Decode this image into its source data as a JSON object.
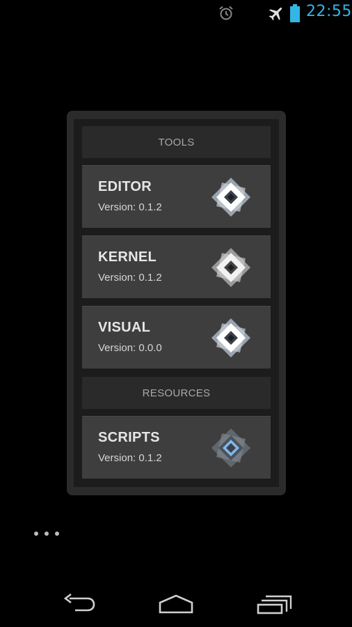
{
  "status_bar": {
    "time": "22:55",
    "icons": [
      "alarm-clock-icon",
      "airplane-mode-icon",
      "battery-icon"
    ],
    "clock_color": "#33b5e5"
  },
  "widget": {
    "sections": [
      {
        "header": "TOOLS",
        "items": [
          {
            "name": "EDITOR",
            "version": "Version: 0.1.2",
            "logo": "diamond-logo-light"
          },
          {
            "name": "KERNEL",
            "version": "Version: 0.1.2",
            "logo": "diamond-logo-light"
          },
          {
            "name": "VISUAL",
            "version": "Version: 0.0.0",
            "logo": "diamond-logo-light"
          }
        ]
      },
      {
        "header": "RESOURCES",
        "items": [
          {
            "name": "SCRIPTS",
            "version": "Version: 0.1.2",
            "logo": "diamond-logo-blue"
          }
        ]
      }
    ]
  },
  "overflow_menu": {
    "icon": "more-dots-icon"
  },
  "nav_bar": {
    "buttons": [
      "back-icon",
      "home-icon",
      "recents-icon"
    ]
  }
}
